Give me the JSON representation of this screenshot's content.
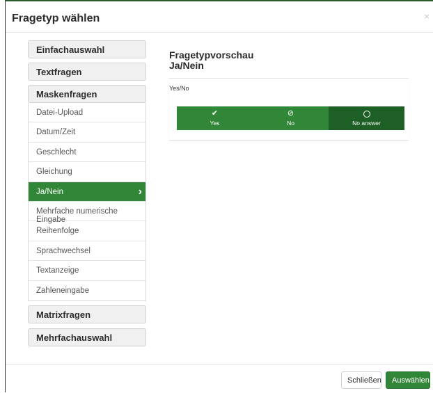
{
  "dialog": {
    "title": "Fragetyp wählen",
    "close_glyph": "×"
  },
  "groups": {
    "einfach": "Einfachauswahl",
    "text": "Textfragen",
    "masken": "Maskenfragen",
    "matrix": "Matrixfragen",
    "mehrfach": "Mehrfachauswahl"
  },
  "masken_items": [
    "Datei-Upload",
    "Datum/Zeit",
    "Geschlecht",
    "Gleichung",
    "Ja/Nein",
    "Mehrfache numerische Eingabe",
    "Reihenfolge",
    "Sprachwechsel",
    "Textanzeige",
    "Zahleneingabe"
  ],
  "active_item": "Ja/Nein",
  "preview": {
    "heading": "Fragetypvorschau",
    "type": "Ja/Nein",
    "question_text": "Yes/No",
    "answers": [
      {
        "label": "Yes",
        "icon": "check-icon"
      },
      {
        "label": "No",
        "icon": "ban-icon"
      },
      {
        "label": "No answer",
        "icon": "circle-icon",
        "selected": true
      }
    ]
  },
  "footer": {
    "close_label": "Schließen",
    "select_label": "Auswählen"
  },
  "colors": {
    "accent": "#328637",
    "accent_dark": "#1d5f24"
  }
}
